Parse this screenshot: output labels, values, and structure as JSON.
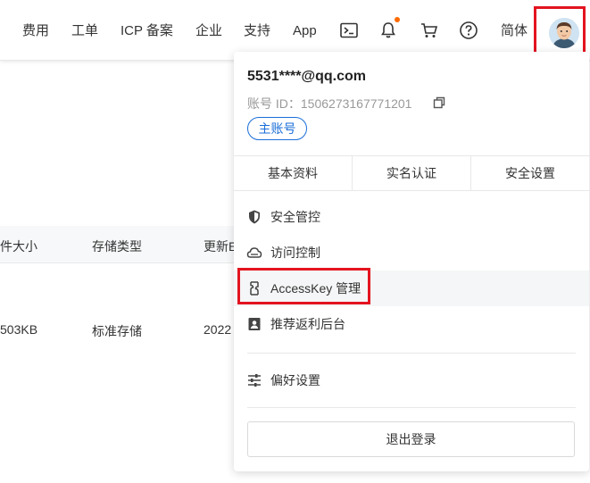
{
  "topnav": {
    "items": [
      "费用",
      "工单",
      "ICP 备案",
      "企业",
      "支持",
      "App"
    ],
    "lang": "简体"
  },
  "table": {
    "headers": [
      "件大小",
      "存储类型",
      "更新E"
    ],
    "row": [
      "503KB",
      "标准存储",
      "2022"
    ]
  },
  "account": {
    "email": "5531****@qq.com",
    "id_label": "账号 ID：1506273167771201",
    "badge": "主账号"
  },
  "tabs": [
    "基本资料",
    "实名认证",
    "安全设置"
  ],
  "menu": [
    {
      "label": "安全管控",
      "icon": "shield-icon"
    },
    {
      "label": "访问控制",
      "icon": "cloud-icon"
    },
    {
      "label": "AccessKey 管理",
      "icon": "key-icon"
    },
    {
      "label": "推荐返利后台",
      "icon": "rebate-icon"
    },
    {
      "label": "偏好设置",
      "icon": "sliders-icon"
    }
  ],
  "logout": "退出登录",
  "colors": {
    "highlight": "#e3141f",
    "accent_blue": "#1a6ed8",
    "notify_dot": "#ff6a00"
  }
}
